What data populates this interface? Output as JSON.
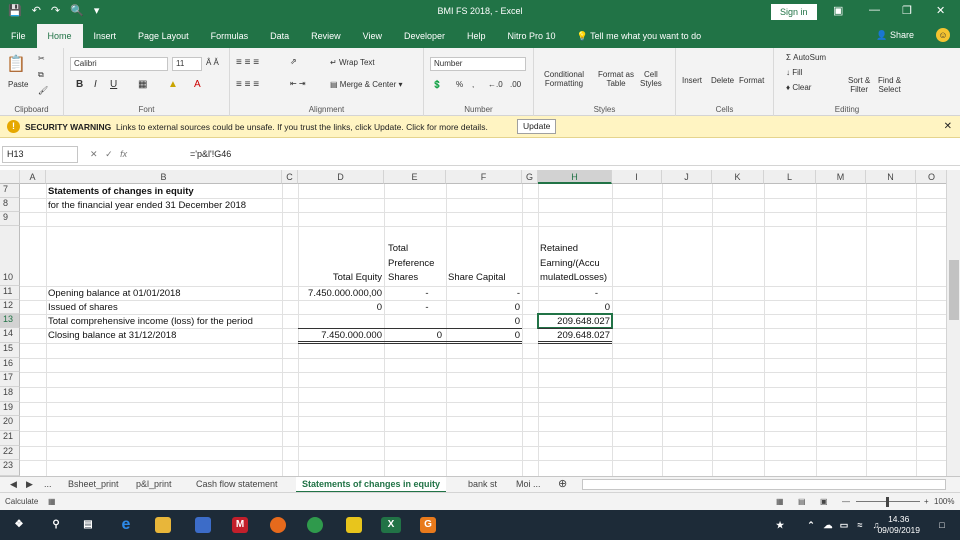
{
  "window": {
    "title": "BMI FS 2018,  -  Excel",
    "signin": "Sign in"
  },
  "tabs": [
    "File",
    "Home",
    "Insert",
    "Page Layout",
    "Formulas",
    "Data",
    "Review",
    "View",
    "Developer",
    "Help",
    "Nitro Pro 10"
  ],
  "active_tab": "Home",
  "tell_me": "Tell me what you want to do",
  "share_label": "Share",
  "ribbon": {
    "clipboard": {
      "label": "Clipboard",
      "paste": "Paste"
    },
    "font": {
      "label": "Font",
      "name": "Calibri",
      "size": "11"
    },
    "alignment": {
      "label": "Alignment",
      "wrap": "Wrap Text",
      "merge": "Merge & Center"
    },
    "number": {
      "label": "Number",
      "format": "Number"
    },
    "styles": {
      "label": "Styles",
      "conditional": "Conditional",
      "formatting": "Formatting",
      "format_as": "Format as",
      "table": "Table",
      "cell": "Cell",
      "cell_styles": "Styles"
    },
    "cells": {
      "label": "Cells",
      "insert": "Insert",
      "delete": "Delete",
      "format": "Format"
    },
    "editing": {
      "label": "Editing",
      "autosum": "AutoSum",
      "fill": "Fill",
      "clear": "Clear",
      "sort": "Sort &",
      "filter": "Filter",
      "find": "Find &",
      "select": "Select"
    }
  },
  "security": {
    "title": "SECURITY WARNING",
    "message": "Links to external sources could be unsafe. If you trust the links, click Update. Click for more details.",
    "button": "Update"
  },
  "formula_bar": {
    "name_box": "H13",
    "formula": "='p&l'!G46"
  },
  "columns": [
    "A",
    "B",
    "C",
    "D",
    "E",
    "F",
    "G",
    "H",
    "I",
    "J",
    "K",
    "L",
    "M",
    "N",
    "O"
  ],
  "selected_column": "H",
  "rows": [
    "7",
    "8",
    "9",
    "10",
    "11",
    "12",
    "13",
    "14",
    "15",
    "16",
    "17",
    "18",
    "19",
    "20",
    "21",
    "22",
    "23"
  ],
  "selected_row": "13",
  "sheet": {
    "title": "Statements of changes in equity",
    "subtitle": "for the financial year ended 31 December 2018",
    "hdr_d": "Total Equity",
    "hdr_e1": "Total",
    "hdr_e2": "Preference",
    "hdr_e3": "Shares",
    "hdr_f": "Share Capital",
    "hdr_h1": "Retained",
    "hdr_h2": "Earning/(Accu",
    "hdr_h3": "mulatedLosses)",
    "r11_b": "Opening balance at 01/01/2018",
    "r11_d": "7.450.000.000,00",
    "r11_e": "-",
    "r11_f": "-",
    "r11_h": "-",
    "r12_b": "Issued of shares",
    "r12_d": "0",
    "r12_e": "-",
    "r12_f": "0",
    "r12_h": "0",
    "r13_b": "Total comprehensive income (loss) for the period",
    "r13_f": "0",
    "r13_h": "209.648.027",
    "r14_b": "Closing balance at 31/12/2018",
    "r14_d": "7.450.000.000",
    "r14_e": "0",
    "r14_f": "0",
    "r14_h": "209.648.027"
  },
  "sheet_tabs": {
    "more_left": "...",
    "t1": "Bsheet_print",
    "t2": "p&l_print",
    "t3": "Cash flow statement",
    "t4": "Statements of changes in equity",
    "t5": "bank st",
    "t6": "Moi ..."
  },
  "status": {
    "mode": "Calculate",
    "zoom": "100%"
  },
  "taskbar": {
    "time": "14.36",
    "date": "09/09/2019"
  }
}
